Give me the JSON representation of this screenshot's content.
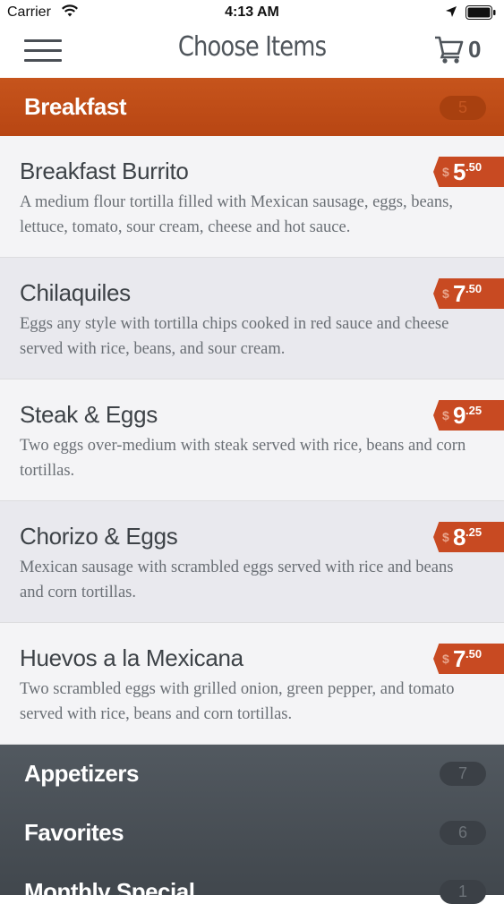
{
  "status_bar": {
    "carrier": "Carrier",
    "time": "4:13 AM"
  },
  "nav": {
    "title": "Choose Items",
    "cart_count": "0"
  },
  "current_category": {
    "name": "Breakfast",
    "count": "5"
  },
  "items": [
    {
      "name": "Breakfast Burrito",
      "description": "A medium flour tortilla filled with Mexican sausage, eggs, beans, lettuce, tomato, sour cream, cheese and hot  sauce.",
      "currency": "$",
      "dollars": "5",
      "cents": ".50"
    },
    {
      "name": "Chilaquiles",
      "description": "Eggs any style with tortilla chips cooked in red sauce and cheese served with rice, beans, and sour cream.",
      "currency": "$",
      "dollars": "7",
      "cents": ".50"
    },
    {
      "name": "Steak & Eggs",
      "description": "Two eggs over-medium with steak served with rice, beans and corn tortillas.",
      "currency": "$",
      "dollars": "9",
      "cents": ".25"
    },
    {
      "name": "Chorizo & Eggs",
      "description": "Mexican sausage with scrambled eggs served with rice and beans and corn tortillas.",
      "currency": "$",
      "dollars": "8",
      "cents": ".25"
    },
    {
      "name": "Huevos a la Mexicana",
      "description": "Two scrambled eggs with grilled onion, green pepper, and tomato served with rice, beans and corn tortillas.",
      "currency": "$",
      "dollars": "7",
      "cents": ".50"
    }
  ],
  "other_categories": [
    {
      "name": "Appetizers",
      "count": "7"
    },
    {
      "name": "Favorites",
      "count": "6"
    },
    {
      "name": "Monthly Special",
      "count": "1"
    }
  ],
  "colors": {
    "accent": "#c6541c",
    "price_tag": "#c84a22",
    "dark_panel": "#4a5056"
  },
  "icons": [
    "wifi-icon",
    "location-arrow-icon",
    "battery-icon",
    "hamburger-menu-icon",
    "shopping-cart-icon"
  ]
}
